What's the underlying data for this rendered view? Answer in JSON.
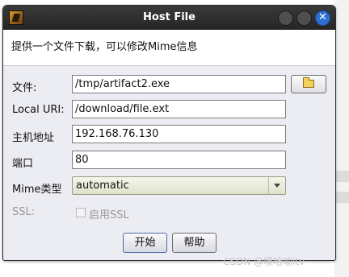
{
  "window": {
    "title": "Host File",
    "close_glyph": "✕"
  },
  "intro_text": "提供一个文件下载，可以修改Mime信息",
  "form": {
    "file": {
      "label": "文件:",
      "value": "/tmp/artifact2.exe"
    },
    "local_uri": {
      "label": "Local URI:",
      "value": "/download/file.ext"
    },
    "host": {
      "label": "主机地址",
      "value": "192.168.76.130"
    },
    "port": {
      "label": "端口",
      "value": "80"
    },
    "mime": {
      "label": "Mime类型",
      "value": "automatic"
    },
    "ssl": {
      "label": "SSL:",
      "checkbox_label": "启用SSL",
      "checked": false,
      "enabled": false
    }
  },
  "buttons": {
    "start": "开始",
    "help": "帮助"
  },
  "icons": {
    "app": "app-icon",
    "browse": "folder-icon",
    "dropdown": "chevron-down-icon"
  },
  "watermark": "CSDN @噢哈喻itv"
}
